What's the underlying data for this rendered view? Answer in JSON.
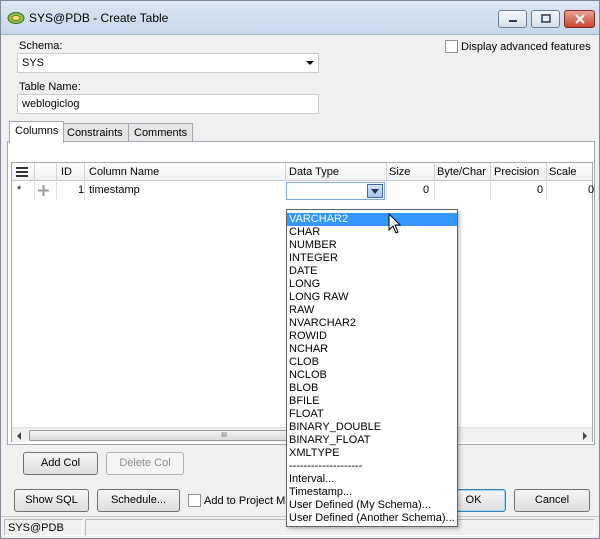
{
  "window": {
    "title": "SYS@PDB - Create Table",
    "minimize_label": "minimize",
    "maximize_label": "maximize",
    "close_label": "close"
  },
  "form": {
    "schema_label": "Schema:",
    "schema_value": "SYS",
    "advanced_label": "Display advanced features",
    "table_name_label": "Table Name:",
    "table_name_value": "weblogiclog"
  },
  "tabs": [
    {
      "label": "Columns",
      "active": true
    },
    {
      "label": "Constraints",
      "active": false
    },
    {
      "label": "Comments",
      "active": false
    }
  ],
  "grid": {
    "headers": {
      "id": "ID",
      "column_name": "Column Name",
      "data_type": "Data Type",
      "size": "Size",
      "byte_char": "Byte/Char",
      "precision": "Precision",
      "scale": "Scale"
    },
    "row": {
      "marker": "*",
      "id": "1",
      "column_name": "timestamp",
      "data_type": "",
      "size": "0",
      "precision": "0",
      "scale": "0"
    },
    "scroll_grip": "III"
  },
  "datatype_options": [
    "VARCHAR2",
    "CHAR",
    "NUMBER",
    "INTEGER",
    "DATE",
    "LONG",
    "LONG RAW",
    "RAW",
    "NVARCHAR2",
    "ROWID",
    "NCHAR",
    "CLOB",
    "NCLOB",
    "BLOB",
    "BFILE",
    "FLOAT",
    "BINARY_DOUBLE",
    "BINARY_FLOAT",
    "XMLTYPE",
    "--------------------",
    "Interval...",
    "Timestamp...",
    "User Defined (My Schema)...",
    "User Defined (Another Schema)..."
  ],
  "datatype_highlighted": "VARCHAR2",
  "buttons": {
    "add_col": "Add Col",
    "delete_col": "Delete Col",
    "show_sql": "Show SQL",
    "schedule": "Schedule...",
    "add_to_project": "Add to Project Ma",
    "ok": "OK",
    "cancel": "Cancel"
  },
  "status": {
    "connection": "SYS@PDB"
  },
  "colors": {
    "selection": "#3399ff",
    "title_bar": "#c7d7ea"
  }
}
